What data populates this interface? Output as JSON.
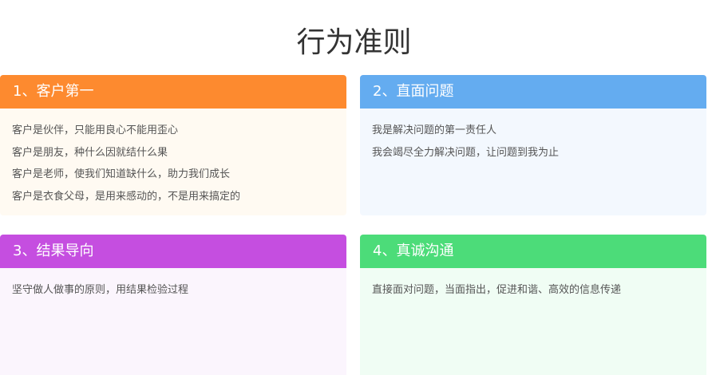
{
  "title": "行为准则",
  "cards": [
    {
      "heading": "1、客户第一",
      "header_color": "#fd8a2f",
      "body_color": "#fffaf2",
      "lines": [
        "客户是伙伴，只能用良心不能用歪心",
        "客户是朋友，种什么因就结什么果",
        "客户是老师，使我们知道缺什么，助力我们成长",
        "客户是衣食父母，是用来感动的，不是用来搞定的"
      ]
    },
    {
      "heading": "2、直面问题",
      "header_color": "#64acf0",
      "body_color": "#f3f8fe",
      "lines": [
        "我是解决问题的第一责任人",
        "我会竭尽全力解决问题，让问题到我为止"
      ]
    },
    {
      "heading": "3、结果导向",
      "header_color": "#c54ee0",
      "body_color": "#fbf5fd",
      "lines": [
        "坚守做人做事的原则，用结果检验过程"
      ]
    },
    {
      "heading": "4、真诚沟通",
      "header_color": "#4cdc79",
      "body_color": "#f0fdf4",
      "lines": [
        "直接面对问题，当面指出，促进和谐、高效的信息传递"
      ]
    }
  ]
}
